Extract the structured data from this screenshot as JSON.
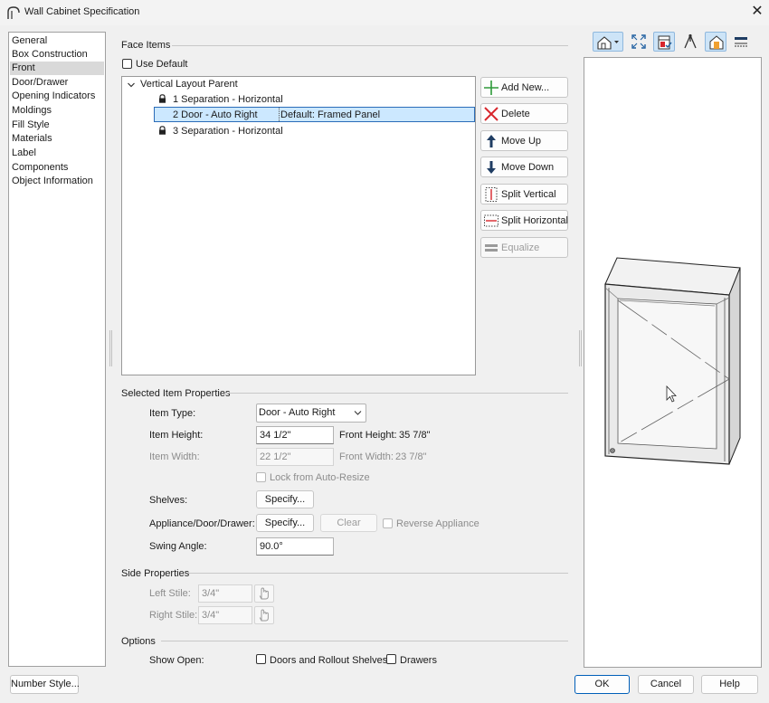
{
  "window": {
    "title": "Wall Cabinet Specification",
    "close_glyph": "✕"
  },
  "nav": {
    "items": [
      "General",
      "Box Construction",
      "Front",
      "Door/Drawer",
      "Opening Indicators",
      "Moldings",
      "Fill Style",
      "Materials",
      "Label",
      "Components",
      "Object Information"
    ],
    "selected": "Front"
  },
  "face_items": {
    "group_label": "Face Items",
    "use_default_label": "Use Default",
    "use_default_checked": false,
    "tree": {
      "root": "Vertical Layout Parent",
      "rows": [
        {
          "name": "1 Separation - Horizontal",
          "detail": "",
          "locked": true,
          "selected": false
        },
        {
          "name": "2 Door - Auto Right",
          "detail": "Default: Framed Panel",
          "locked": false,
          "selected": true
        },
        {
          "name": "3 Separation - Horizontal",
          "detail": "",
          "locked": true,
          "selected": false
        }
      ]
    },
    "buttons": {
      "add_new": "Add New...",
      "delete": "Delete",
      "move_up": "Move Up",
      "move_down": "Move Down",
      "split_vertical": "Split Vertical",
      "split_horizontal": "Split Horizontal",
      "equalize": "Equalize"
    }
  },
  "selected_item": {
    "group_label": "Selected Item Properties",
    "item_type_label": "Item Type:",
    "item_type_value": "Door - Auto Right",
    "item_height_label": "Item Height:",
    "item_height_value": "34 1/2\"",
    "front_height_label": "Front Height:",
    "front_height_value": "35 7/8\"",
    "item_width_label": "Item Width:",
    "item_width_value": "22 1/2\"",
    "front_width_label": "Front Width:",
    "front_width_value": "23 7/8\"",
    "lock_label": "Lock from Auto-Resize",
    "shelves_label": "Shelves:",
    "shelves_button": "Specify...",
    "appliance_label": "Appliance/Door/Drawer:",
    "appliance_button": "Specify...",
    "clear_button": "Clear",
    "reverse_label": "Reverse Appliance",
    "swing_label": "Swing Angle:",
    "swing_value": "90.0°"
  },
  "side_properties": {
    "group_label": "Side Properties",
    "left_stile_label": "Left Stile:",
    "left_stile_value": "3/4\"",
    "right_stile_label": "Right Stile:",
    "right_stile_value": "3/4\""
  },
  "options": {
    "group_label": "Options",
    "show_open_label": "Show Open:",
    "doors_label": "Doors and Rollout Shelves",
    "drawers_label": "Drawers"
  },
  "preview_toolbar": [
    "home-view-icon",
    "fit-window-icon",
    "render-mode-icon",
    "perspective-icon",
    "materials-icon",
    "elevation-icon"
  ],
  "footer": {
    "number_style": "Number Style...",
    "ok": "OK",
    "cancel": "Cancel",
    "help": "Help"
  },
  "colors": {
    "selection": "#cce8ff",
    "accent": "#005fb8",
    "toolbar_on": "#cde4f7"
  }
}
